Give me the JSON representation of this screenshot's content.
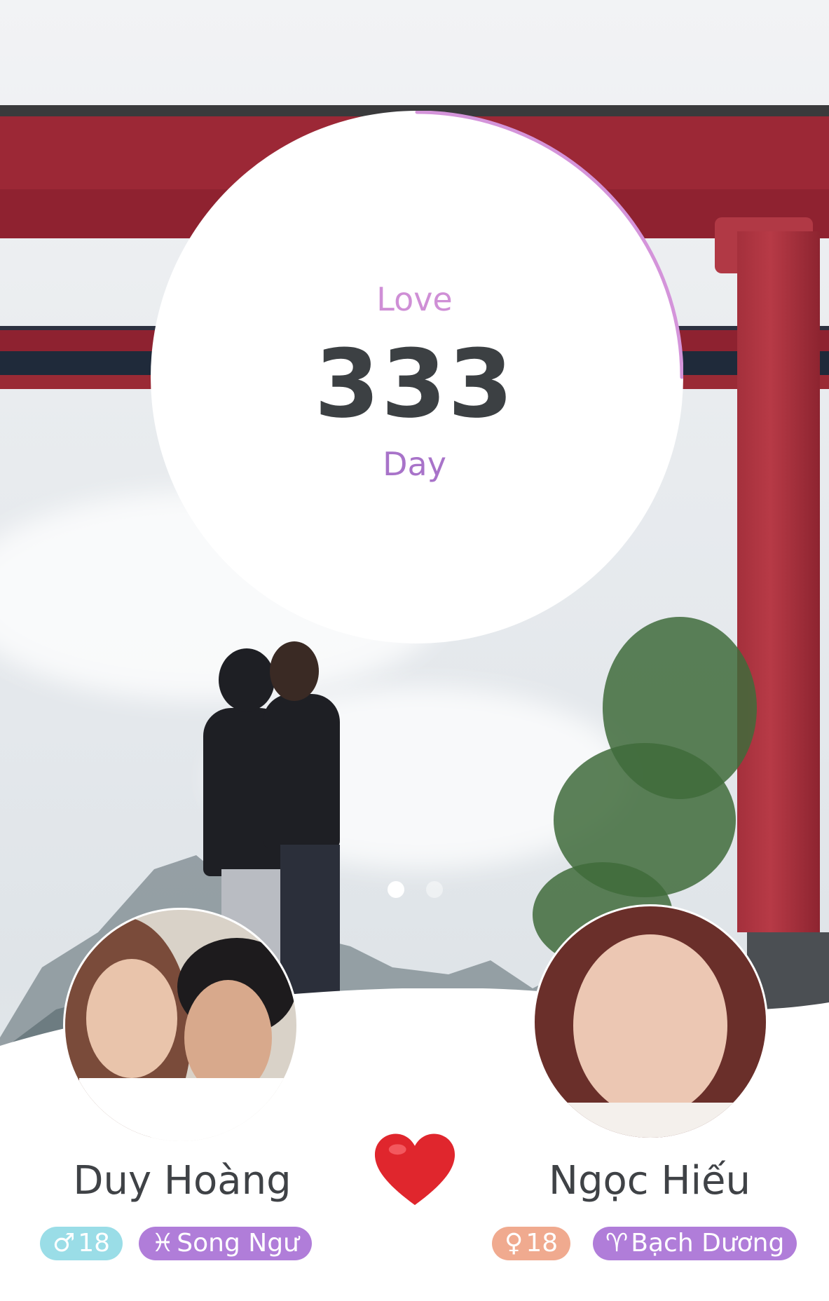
{
  "counter": {
    "top_label": "Love",
    "days": "333",
    "bottom_label": "Day",
    "progress_fraction": 0.25,
    "ring_color": "#d494da"
  },
  "carousel": {
    "page_count": 2,
    "active_index": 0
  },
  "partner_left": {
    "name": "Duy Hoàng",
    "gender_symbol": "♂",
    "age": "18",
    "zodiac_symbol": "♓",
    "zodiac": "Song Ngư"
  },
  "partner_right": {
    "name": "Ngọc Hiếu",
    "gender_symbol": "♀",
    "age": "18",
    "zodiac_symbol": "♈",
    "zodiac": "Bạch Dương"
  },
  "heart_icon": "heart-icon",
  "colors": {
    "love_label": "#cf8fd6",
    "day_label": "#a873c9",
    "male_badge": "#9adde7",
    "female_badge": "#f0aa8f",
    "zodiac_badge": "#b07dd9",
    "heart": "#e0262d"
  }
}
